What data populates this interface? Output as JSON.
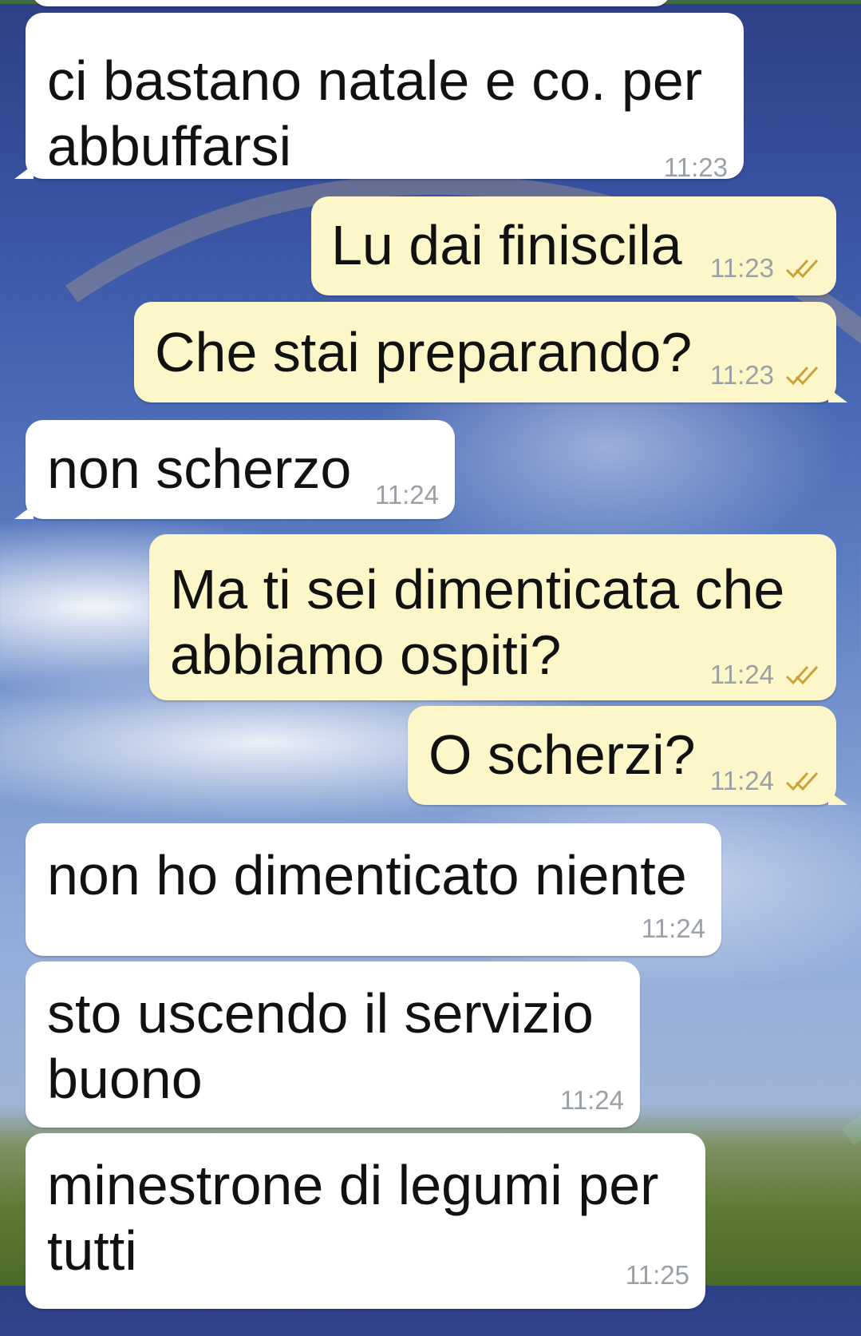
{
  "chat": {
    "messages": [
      {
        "direction": "incoming",
        "lines": [
          "ci bastano natale e co. per",
          "abbuffarsi"
        ],
        "time": "11:23"
      },
      {
        "direction": "outgoing",
        "lines": [
          "Lu dai finiscila"
        ],
        "time": "11:23",
        "status": "read"
      },
      {
        "direction": "outgoing",
        "lines": [
          "Che stai preparando?"
        ],
        "time": "11:23",
        "status": "read"
      },
      {
        "direction": "incoming",
        "lines": [
          "non scherzo"
        ],
        "time": "11:24"
      },
      {
        "direction": "outgoing",
        "lines": [
          "Ma ti sei dimenticata che",
          "abbiamo ospiti?"
        ],
        "time": "11:24",
        "status": "read"
      },
      {
        "direction": "outgoing",
        "lines": [
          "O scherzi?"
        ],
        "time": "11:24",
        "status": "read"
      },
      {
        "direction": "incoming",
        "lines": [
          "non ho dimenticato niente"
        ],
        "time": "11:24"
      },
      {
        "direction": "incoming",
        "lines": [
          "sto uscendo il servizio",
          "buono"
        ],
        "time": "11:24"
      },
      {
        "direction": "incoming",
        "lines": [
          "minestrone di legumi per",
          "tutti"
        ],
        "time": "11:25"
      }
    ]
  },
  "icons": {
    "read_receipt": "double-check-icon"
  },
  "colors": {
    "incoming_bubble": "#ffffff",
    "outgoing_bubble": "#fdf6c9",
    "timestamp": "#9aa0a6",
    "read_check": "#c9a13a"
  }
}
